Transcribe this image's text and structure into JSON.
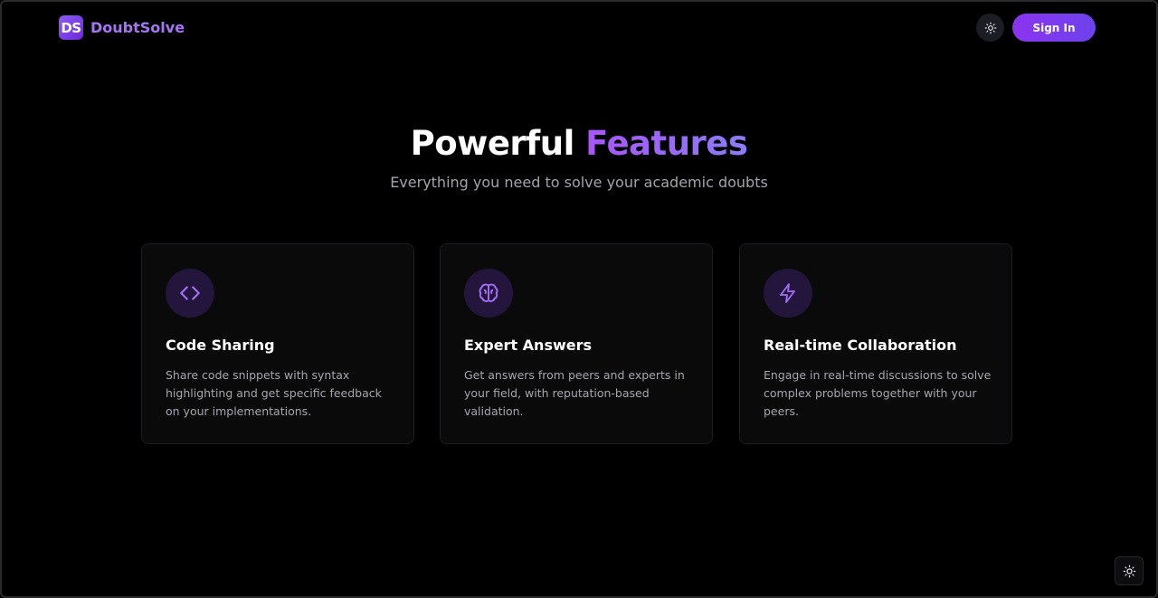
{
  "header": {
    "brand_badge": "DS",
    "brand_name": "DoubtSolve",
    "theme_toggle_icon": "sun-icon",
    "signin_label": "Sign In"
  },
  "hero": {
    "title_main": "Powerful",
    "title_accent": "Features",
    "subtitle": "Everything you need to solve your academic doubts"
  },
  "features": [
    {
      "icon": "code-icon",
      "title": "Code Sharing",
      "description": "Share code snippets with syntax highlighting and get specific feedback on your implementations."
    },
    {
      "icon": "brain-icon",
      "title": "Expert Answers",
      "description": "Get answers from peers and experts in your field, with reputation-based validation."
    },
    {
      "icon": "lightning-icon",
      "title": "Real-time Collaboration",
      "description": "Engage in real-time discussions to solve complex problems together with your peers."
    }
  ],
  "floating_theme_icon": "sun-icon",
  "colors": {
    "background": "#000000",
    "brand_purple": "#a675f5",
    "accent_gradient_start": "#a855f7",
    "accent_gradient_end": "#8b7cf6",
    "button_gradient_start": "#8b34f0",
    "button_gradient_end": "#6d42ec",
    "icon_bg": "#24153d",
    "icon_stroke": "#a36ef5"
  }
}
